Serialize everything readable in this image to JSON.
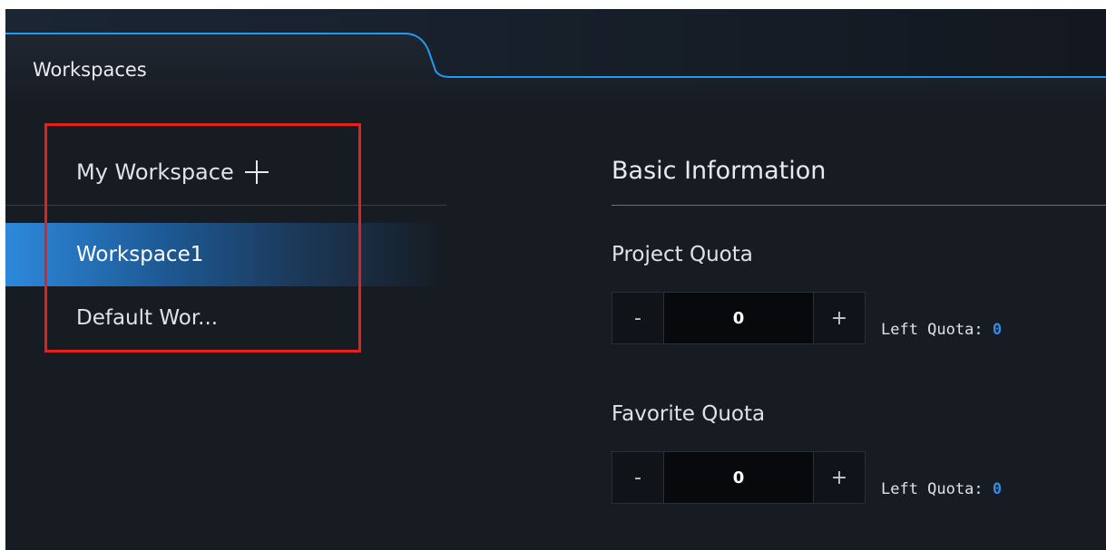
{
  "tabs": [
    {
      "label": "Workspaces",
      "active": true
    }
  ],
  "sidebar": {
    "header_label": "My Workspace",
    "items": [
      {
        "label": "Workspace1",
        "active": true
      },
      {
        "label": "Default Wor...",
        "active": false
      }
    ]
  },
  "main": {
    "section_title": "Basic Information",
    "project_quota": {
      "label": "Project Quota",
      "value": "0",
      "minus": "-",
      "plus": "+",
      "left_label": "Left Quota:",
      "left_value": "0"
    },
    "favorite_quota": {
      "label": "Favorite Quota",
      "value": "0",
      "minus": "-",
      "plus": "+",
      "left_label": "Left Quota:",
      "left_value": "0"
    }
  },
  "colors": {
    "background": "#171b22",
    "accent": "#2e8de4",
    "highlight": "#e3201b"
  }
}
